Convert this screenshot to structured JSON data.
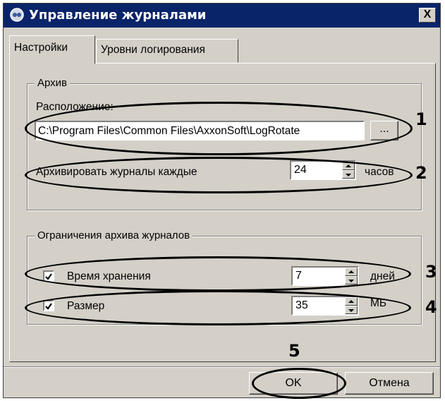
{
  "window": {
    "title": "Управление журналами",
    "close_label": "X"
  },
  "tabs": [
    {
      "label": "Настройки",
      "active": true
    },
    {
      "label": "Уровни логирования",
      "active": false
    }
  ],
  "archive": {
    "group_label": "Архив",
    "location_label": "Расположение:",
    "location_value": "C:\\Program Files\\Common Files\\AxxonSoft\\LogRotate",
    "browse_label": "...",
    "interval_label": "Архивировать журналы каждые",
    "interval_value": "24",
    "interval_unit": "часов"
  },
  "limits": {
    "group_label": "Ограничения архива журналов",
    "retention": {
      "label": "Время хранения",
      "checked": true,
      "value": "7",
      "unit": "дней"
    },
    "size": {
      "label": "Размер",
      "checked": true,
      "value": "35",
      "unit": "МБ"
    }
  },
  "buttons": {
    "ok_label": "OK",
    "cancel_label": "Отмена"
  },
  "callouts": [
    "1",
    "2",
    "3",
    "4",
    "5"
  ]
}
